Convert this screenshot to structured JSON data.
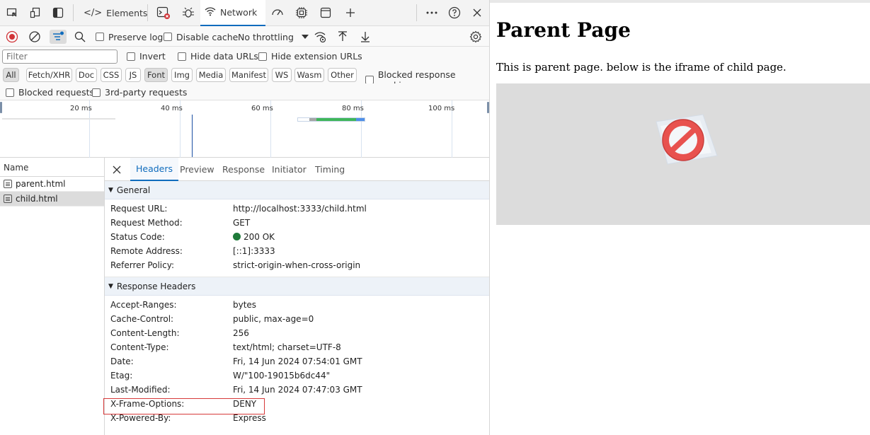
{
  "devtools": {
    "tabs": {
      "elements": "Elements",
      "network": "Network"
    },
    "toolbar": {
      "preserve_log": "Preserve log",
      "disable_cache": "Disable cache",
      "throttling": "No throttling"
    },
    "filter": {
      "placeholder": "Filter",
      "invert": "Invert",
      "hide_data_urls": "Hide data URLs",
      "hide_extension_urls": "Hide extension URLs"
    },
    "types": [
      "All",
      "Fetch/XHR",
      "Doc",
      "CSS",
      "JS",
      "Font",
      "Img",
      "Media",
      "Manifest",
      "WS",
      "Wasm",
      "Other"
    ],
    "blocked_response_cookies": "Blocked response cookies",
    "blocked_requests": "Blocked requests",
    "third_party_requests": "3rd-party requests",
    "timeline_labels": [
      "20 ms",
      "40 ms",
      "60 ms",
      "80 ms",
      "100 ms"
    ],
    "request_list": {
      "header": "Name",
      "rows": [
        "parent.html",
        "child.html"
      ]
    },
    "detail_tabs": [
      "Headers",
      "Preview",
      "Response",
      "Initiator",
      "Timing"
    ],
    "general": {
      "title": "General",
      "rows": [
        {
          "key": "Request URL:",
          "value": "http://localhost:3333/child.html"
        },
        {
          "key": "Request Method:",
          "value": "GET"
        },
        {
          "key": "Status Code:",
          "value": "200 OK"
        },
        {
          "key": "Remote Address:",
          "value": "[::1]:3333"
        },
        {
          "key": "Referrer Policy:",
          "value": "strict-origin-when-cross-origin"
        }
      ]
    },
    "response_headers": {
      "title": "Response Headers",
      "rows": [
        {
          "key": "Accept-Ranges:",
          "value": "bytes"
        },
        {
          "key": "Cache-Control:",
          "value": "public, max-age=0"
        },
        {
          "key": "Content-Length:",
          "value": "256"
        },
        {
          "key": "Content-Type:",
          "value": "text/html; charset=UTF-8"
        },
        {
          "key": "Date:",
          "value": "Fri, 14 Jun 2024 07:54:01 GMT"
        },
        {
          "key": "Etag:",
          "value": "W/\"100-19015b6dc44\""
        },
        {
          "key": "Last-Modified:",
          "value": "Fri, 14 Jun 2024 07:47:03 GMT"
        },
        {
          "key": "X-Frame-Options:",
          "value": "DENY"
        },
        {
          "key": "X-Powered-By:",
          "value": "Express"
        }
      ]
    }
  },
  "page": {
    "title": "Parent Page",
    "text": "This is parent page. below is the iframe of child page."
  }
}
